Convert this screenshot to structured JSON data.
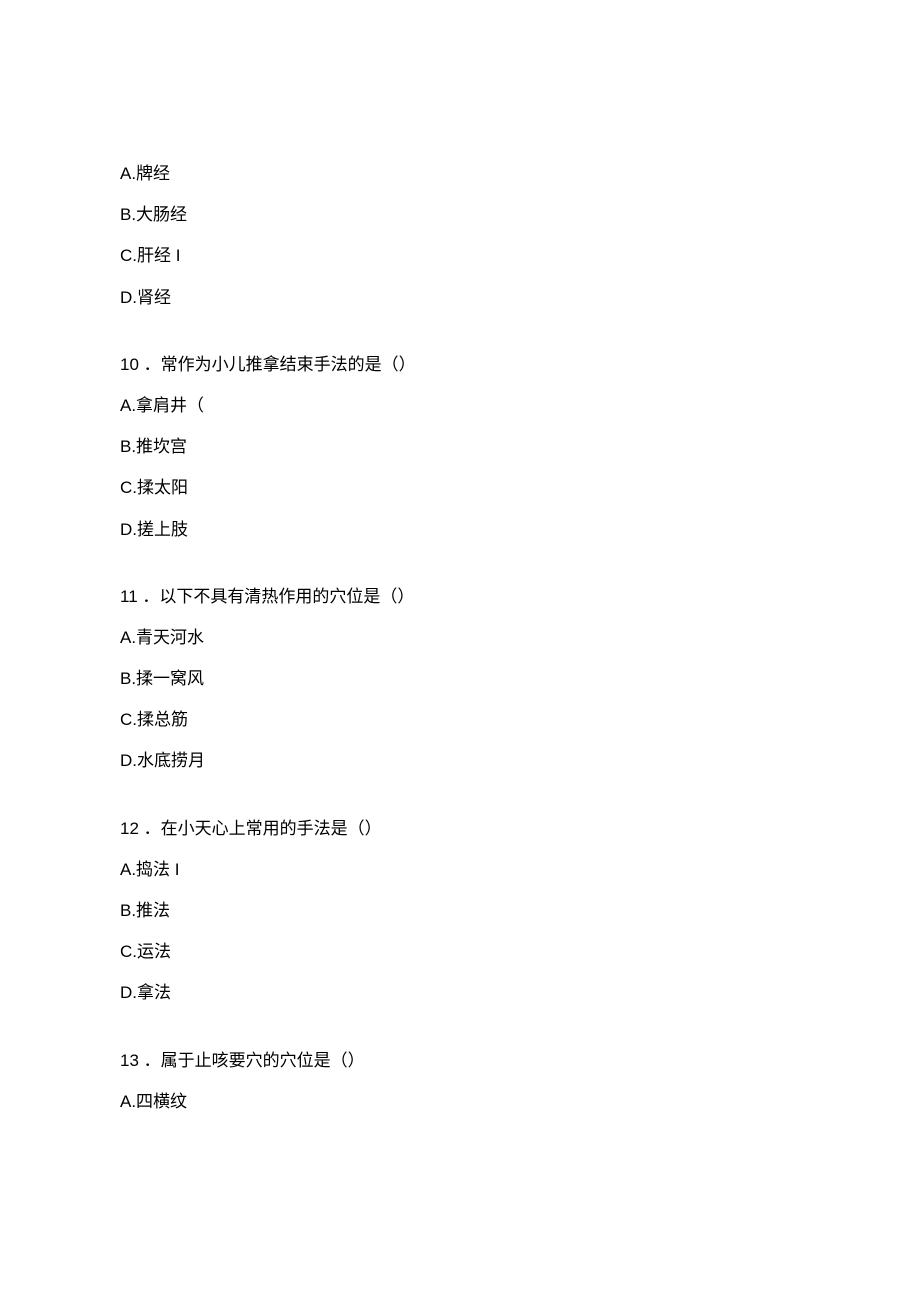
{
  "q9_options": {
    "a": "A.牌经",
    "b": "B.大肠经",
    "c": "C.肝经 I",
    "d": "D.肾经"
  },
  "q10": {
    "question": "10 ．常作为小儿推拿结束手法的是（）",
    "options": {
      "a": "A.拿肩井（",
      "b": "B.推坎宫",
      "c": "C.揉太阳",
      "d": "D.搓上肢"
    }
  },
  "q11": {
    "question": "11 ．以下不具有清热作用的穴位是（）",
    "options": {
      "a": "A.青天河水",
      "b": "B.揉一窝风",
      "c": "C.揉总筋",
      "d": "D.水底捞月"
    }
  },
  "q12": {
    "question": "12 ．在小天心上常用的手法是（）",
    "options": {
      "a": "A.捣法 I",
      "b": "B.推法",
      "c": "C.运法",
      "d": "D.拿法"
    }
  },
  "q13": {
    "question": "13 ．属于止咳要穴的穴位是（）",
    "options": {
      "a": "A.四横纹"
    }
  }
}
